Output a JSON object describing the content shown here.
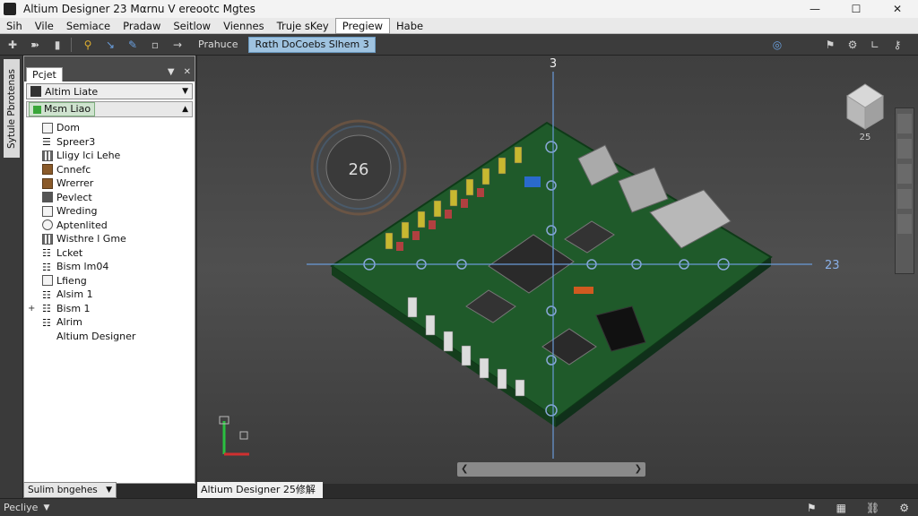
{
  "window": {
    "title": "Altium Designer 23 Mαrnu V ereootc Mgtes",
    "minimize_icon": "minimize-icon",
    "maximize_icon": "maximize-icon",
    "close_icon": "close-icon"
  },
  "menubar": {
    "items": [
      "Sih",
      "Vile",
      "Semiace",
      "Pradaw",
      "Seitlow",
      "Viennes",
      "Truje sKey",
      "Pregiew",
      "Habe"
    ],
    "active_index": 7
  },
  "toolbar": {
    "doc_tabs": [
      "Prahuce",
      "Rαth DoCoebs Slhem 3"
    ],
    "active_tab": 1
  },
  "side_strip": {
    "tab_label": "Sytule Pbrotenas"
  },
  "project_panel": {
    "tab_label": "Pcjet",
    "project_combo": "Altim Liate",
    "document_combo": "Msm Liao",
    "tree_items": [
      {
        "label": "Dom",
        "icon": "square-icon",
        "expander": ""
      },
      {
        "label": "Spreer3",
        "icon": "list-icon",
        "expander": ""
      },
      {
        "label": "Lligy lci Lehe",
        "icon": "grid-icon",
        "expander": ""
      },
      {
        "label": "Cnnefc",
        "icon": "component-icon",
        "expander": ""
      },
      {
        "label": "Wrerrer",
        "icon": "brick-icon",
        "expander": ""
      },
      {
        "label": "Pevlect",
        "icon": "select-icon",
        "expander": ""
      },
      {
        "label": "Wreding",
        "icon": "wire-icon",
        "expander": ""
      },
      {
        "label": "Aptenlited",
        "icon": "circle-icon",
        "expander": ""
      },
      {
        "label": "Wisthre l Gme",
        "icon": "grid-icon",
        "expander": ""
      },
      {
        "label": "Lcket",
        "icon": "list-icon",
        "expander": ""
      },
      {
        "label": "Bism lm04",
        "icon": "list-icon",
        "expander": ""
      },
      {
        "label": "Lfieng",
        "icon": "square-icon",
        "expander": ""
      },
      {
        "label": "Alsim 1",
        "icon": "list-icon",
        "expander": ""
      },
      {
        "label": "Bism 1",
        "icon": "list-icon",
        "expander": "+"
      },
      {
        "label": "Alrim",
        "icon": "list-icon",
        "expander": ""
      },
      {
        "label": "Altium Designer",
        "icon": "",
        "expander": ""
      }
    ],
    "footer_label": "Sulim bngehes"
  },
  "viewport": {
    "axis_label_top": "3",
    "axis_label_right": "23",
    "compass_value": "26",
    "view_cube_label": "25"
  },
  "view_tab": {
    "label": "Altium Designer 25修解版"
  },
  "statusbar": {
    "text": "Pecliye"
  },
  "colors": {
    "pcb_green": "#1f5a2a",
    "axis_blue": "#6a9ad8",
    "bg": "#4a4a4a"
  }
}
